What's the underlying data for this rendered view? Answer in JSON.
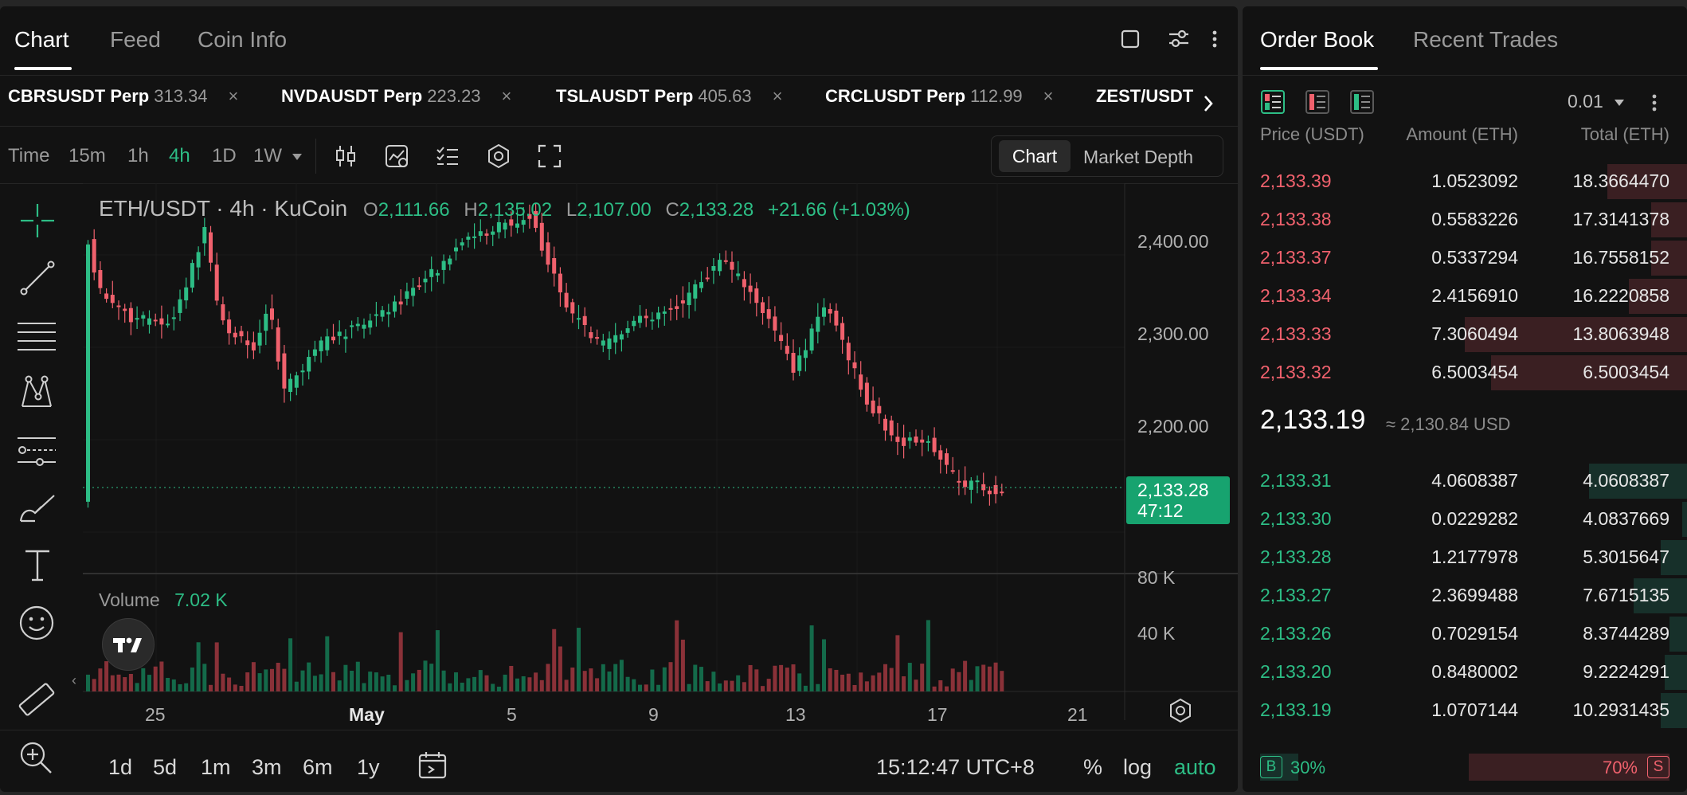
{
  "left_tabs": [
    "Chart",
    "Feed",
    "Coin Info"
  ],
  "symbols": [
    {
      "name": "CBRSUSDT Perp",
      "price": "313.34"
    },
    {
      "name": "NVDAUSDT Perp",
      "price": "223.23"
    },
    {
      "name": "TSLAUSDT Perp",
      "price": "405.63"
    },
    {
      "name": "CRCLUSDT Perp",
      "price": "112.99"
    },
    {
      "name": "ZEST/USDT",
      "price": ""
    }
  ],
  "close_glyph": "×",
  "timeframes": [
    "Time",
    "15m",
    "1h",
    "4h",
    "1D",
    "1W"
  ],
  "view_toggle": [
    "Chart",
    "Market Depth"
  ],
  "legend": {
    "title": "ETH/USDT · 4h · KuCoin",
    "o_label": "O",
    "o": "2,111.66",
    "h_label": "H",
    "h": "2,135.02",
    "l_label": "L",
    "l": "2,107.00",
    "c_label": "C",
    "c": "2,133.28",
    "change": "+21.66 (+1.03%)"
  },
  "y_ticks": [
    "2,400.00",
    "2,300.00",
    "2,200.00"
  ],
  "price_tag": {
    "price": "2,133.28",
    "countdown": "47:12"
  },
  "volume": {
    "label": "Volume",
    "value": "7.02 K",
    "ticks": [
      "80 K",
      "40 K"
    ]
  },
  "x_ticks": [
    "25",
    "May",
    "5",
    "9",
    "13",
    "17",
    "21"
  ],
  "ranges": [
    "1d",
    "5d",
    "1m",
    "3m",
    "6m",
    "1y"
  ],
  "bottom_right": {
    "clock": "15:12:47 UTC+8",
    "pct": "%",
    "log": "log",
    "auto": "auto"
  },
  "right_tabs": [
    "Order Book",
    "Recent Trades"
  ],
  "precision": "0.01",
  "ob_headers": {
    "price": "Price (USDT)",
    "amount": "Amount (ETH)",
    "total": "Total (ETH)"
  },
  "asks": [
    {
      "price": "2,133.39",
      "amount": "1.0523092",
      "total": "18.3664470",
      "depth": 0.18
    },
    {
      "price": "2,133.38",
      "amount": "0.5583226",
      "total": "17.3141378",
      "depth": 0.08
    },
    {
      "price": "2,133.37",
      "amount": "0.5337294",
      "total": "16.7558152",
      "depth": 0.08
    },
    {
      "price": "2,133.34",
      "amount": "2.4156910",
      "total": "16.2220858",
      "depth": 0.13
    },
    {
      "price": "2,133.33",
      "amount": "7.3060494",
      "total": "13.8063948",
      "depth": 0.5
    },
    {
      "price": "2,133.32",
      "amount": "6.5003454",
      "total": "6.5003454",
      "depth": 0.44
    }
  ],
  "mid": {
    "price": "2,133.19",
    "usd": "≈ 2,130.84 USD"
  },
  "bids": [
    {
      "price": "2,133.31",
      "amount": "4.0608387",
      "total": "4.0608387",
      "depth": 0.22
    },
    {
      "price": "2,133.30",
      "amount": "0.0229282",
      "total": "4.0837669",
      "depth": 0.01
    },
    {
      "price": "2,133.28",
      "amount": "1.2177978",
      "total": "5.3015647",
      "depth": 0.06
    },
    {
      "price": "2,133.27",
      "amount": "2.3699488",
      "total": "7.6715135",
      "depth": 0.12
    },
    {
      "price": "2,133.26",
      "amount": "0.7029154",
      "total": "8.3744289",
      "depth": 0.04
    },
    {
      "price": "2,133.20",
      "amount": "0.8480002",
      "total": "9.2224291",
      "depth": 0.05
    },
    {
      "price": "2,133.19",
      "amount": "1.0707144",
      "total": "10.2931435",
      "depth": 0.06
    }
  ],
  "ratio": {
    "b_label": "B",
    "b": "30%",
    "s": "70%",
    "s_label": "S",
    "b_fraction": 0.3
  },
  "colors": {
    "up": "#2dbd85",
    "down": "#f0616d",
    "bg": "#121212"
  }
}
